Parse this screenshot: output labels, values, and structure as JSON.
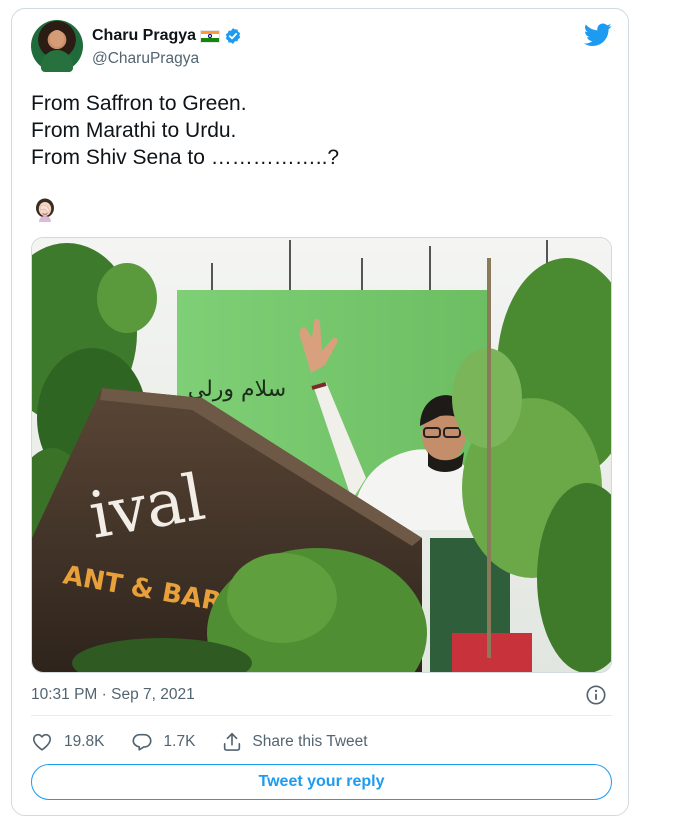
{
  "author": {
    "name": "Charu Pragya",
    "handle": "@CharuPragya",
    "avatar_icon": "profile-photo",
    "flag_icon": "india-flag-icon",
    "verified_icon": "verified-badge-icon"
  },
  "brand_icon": "twitter-bird-icon",
  "tweet": {
    "text": "From Saffron to Green.\nFrom Marathi to Urdu.\nFrom Shiv Sena to ……………..?",
    "emoji": "woman-facepalming-emoji"
  },
  "media": {
    "billboard_text": "سلام ورلی",
    "sign_text_main": "ival",
    "sign_text_sub": "ANT & BAR"
  },
  "meta": {
    "timestamp": "10:31 PM · Sep 7, 2021",
    "info_icon": "info-icon"
  },
  "stats": {
    "likes": "19.8K",
    "replies": "1.7K",
    "share_label": "Share this Tweet"
  },
  "reply_button": {
    "label": "Tweet your reply"
  },
  "colors": {
    "accent": "#1d9bf0",
    "text_secondary": "#536471",
    "border": "#cfd9de"
  }
}
